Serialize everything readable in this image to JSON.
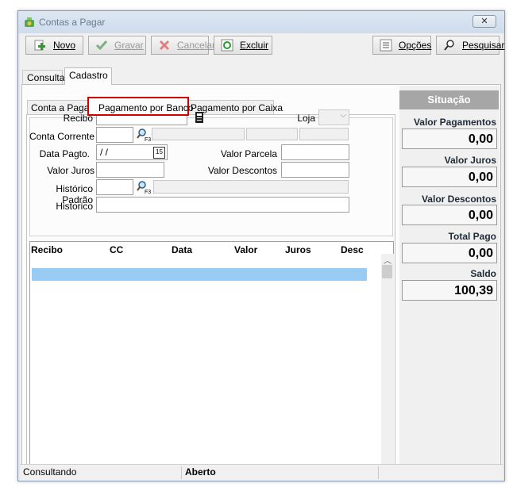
{
  "window": {
    "title": "Contas a Pagar"
  },
  "toolbar": {
    "novo": "Novo",
    "gravar": "Gravar",
    "cancelar": "Cancelar",
    "excluir": "Excluir",
    "opcoes": "Opções",
    "pesquisar": "Pesquisar"
  },
  "tabs": {
    "consulta": "Consulta",
    "cadastro": "Cadastro"
  },
  "subtabs": {
    "conta_a_pagar": "Conta a Pagar",
    "pagamento_banco": "Pagamento por Banco",
    "pagamento_caixa": "Pagamento por Caixa"
  },
  "form": {
    "recibo_label": "Recibo",
    "loja_label": "Loja",
    "conta_corrente_label": "Conta Corrente",
    "data_pagto_label": "Data Pagto.",
    "data_pagto_value": " / /",
    "valor_parcela_label": "Valor Parcela",
    "valor_juros_label": "Valor Juros",
    "valor_descontos_label": "Valor Descontos",
    "historico_padrao_label": "Histórico Padrão",
    "historico_label": "Historico",
    "calendar_text": "15"
  },
  "grid": {
    "columns": [
      "Recibo",
      "CC",
      "Data",
      "Valor",
      "Juros",
      "Desc"
    ]
  },
  "situacao": {
    "header": "Situação",
    "items": [
      {
        "label": "Valor Pagamentos",
        "value": "0,00"
      },
      {
        "label": "Valor Juros",
        "value": "0,00"
      },
      {
        "label": "Valor Descontos",
        "value": "0,00"
      },
      {
        "label": "Total Pago",
        "value": "0,00"
      },
      {
        "label": "Saldo",
        "value": "100,39"
      }
    ]
  },
  "status": {
    "mode": "Consultando",
    "state": "Aberto"
  },
  "colors": {
    "highlight": "#d00000",
    "selected_row": "#99ccf3",
    "situacao_header": "#a6a6a6"
  }
}
